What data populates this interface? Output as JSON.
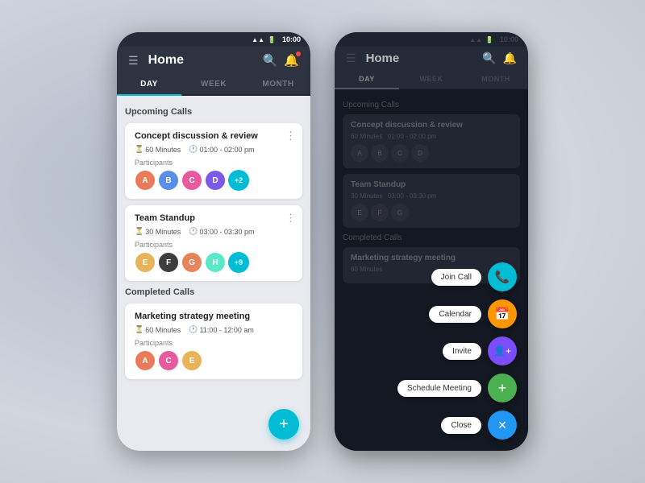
{
  "app": {
    "title": "Home",
    "time": "10:00",
    "tabs": [
      {
        "label": "DAY",
        "active": true
      },
      {
        "label": "WEEK",
        "active": false
      },
      {
        "label": "MONTH",
        "active": false
      }
    ]
  },
  "sections": {
    "upcoming": "Upcoming Calls",
    "completed": "Completed Calls"
  },
  "calls": [
    {
      "id": "call-1",
      "title": "Concept discussion & review",
      "duration": "60 Minutes",
      "time": "01:00 - 02:00 pm",
      "participants_label": "Participants",
      "extra_count": "+2"
    },
    {
      "id": "call-2",
      "title": "Team Standup",
      "duration": "30 Minutes",
      "time": "03:00 - 03:30 pm",
      "participants_label": "Participants",
      "extra_count": "+9"
    }
  ],
  "completed_calls": [
    {
      "id": "call-3",
      "title": "Marketing strategy meeting",
      "duration": "60 Minutes",
      "time": "11:00 - 12:00 am",
      "participants_label": "Participants"
    }
  ],
  "fab_menu": {
    "items": [
      {
        "label": "Join Call",
        "icon": "📞",
        "color": "fab-teal"
      },
      {
        "label": "Calendar",
        "icon": "📅",
        "color": "fab-orange"
      },
      {
        "label": "Invite",
        "icon": "👤+",
        "color": "fab-purple"
      },
      {
        "label": "Schedule Meeting",
        "icon": "+",
        "color": "fab-green"
      }
    ],
    "close_label": "Close",
    "close_icon": "✕",
    "close_color": "fab-blue-x"
  },
  "icons": {
    "hamburger": "☰",
    "search": "🔍",
    "bell": "🔔",
    "hourglass": "⏳",
    "clock": "🕐",
    "more": "⋮",
    "plus": "+"
  }
}
